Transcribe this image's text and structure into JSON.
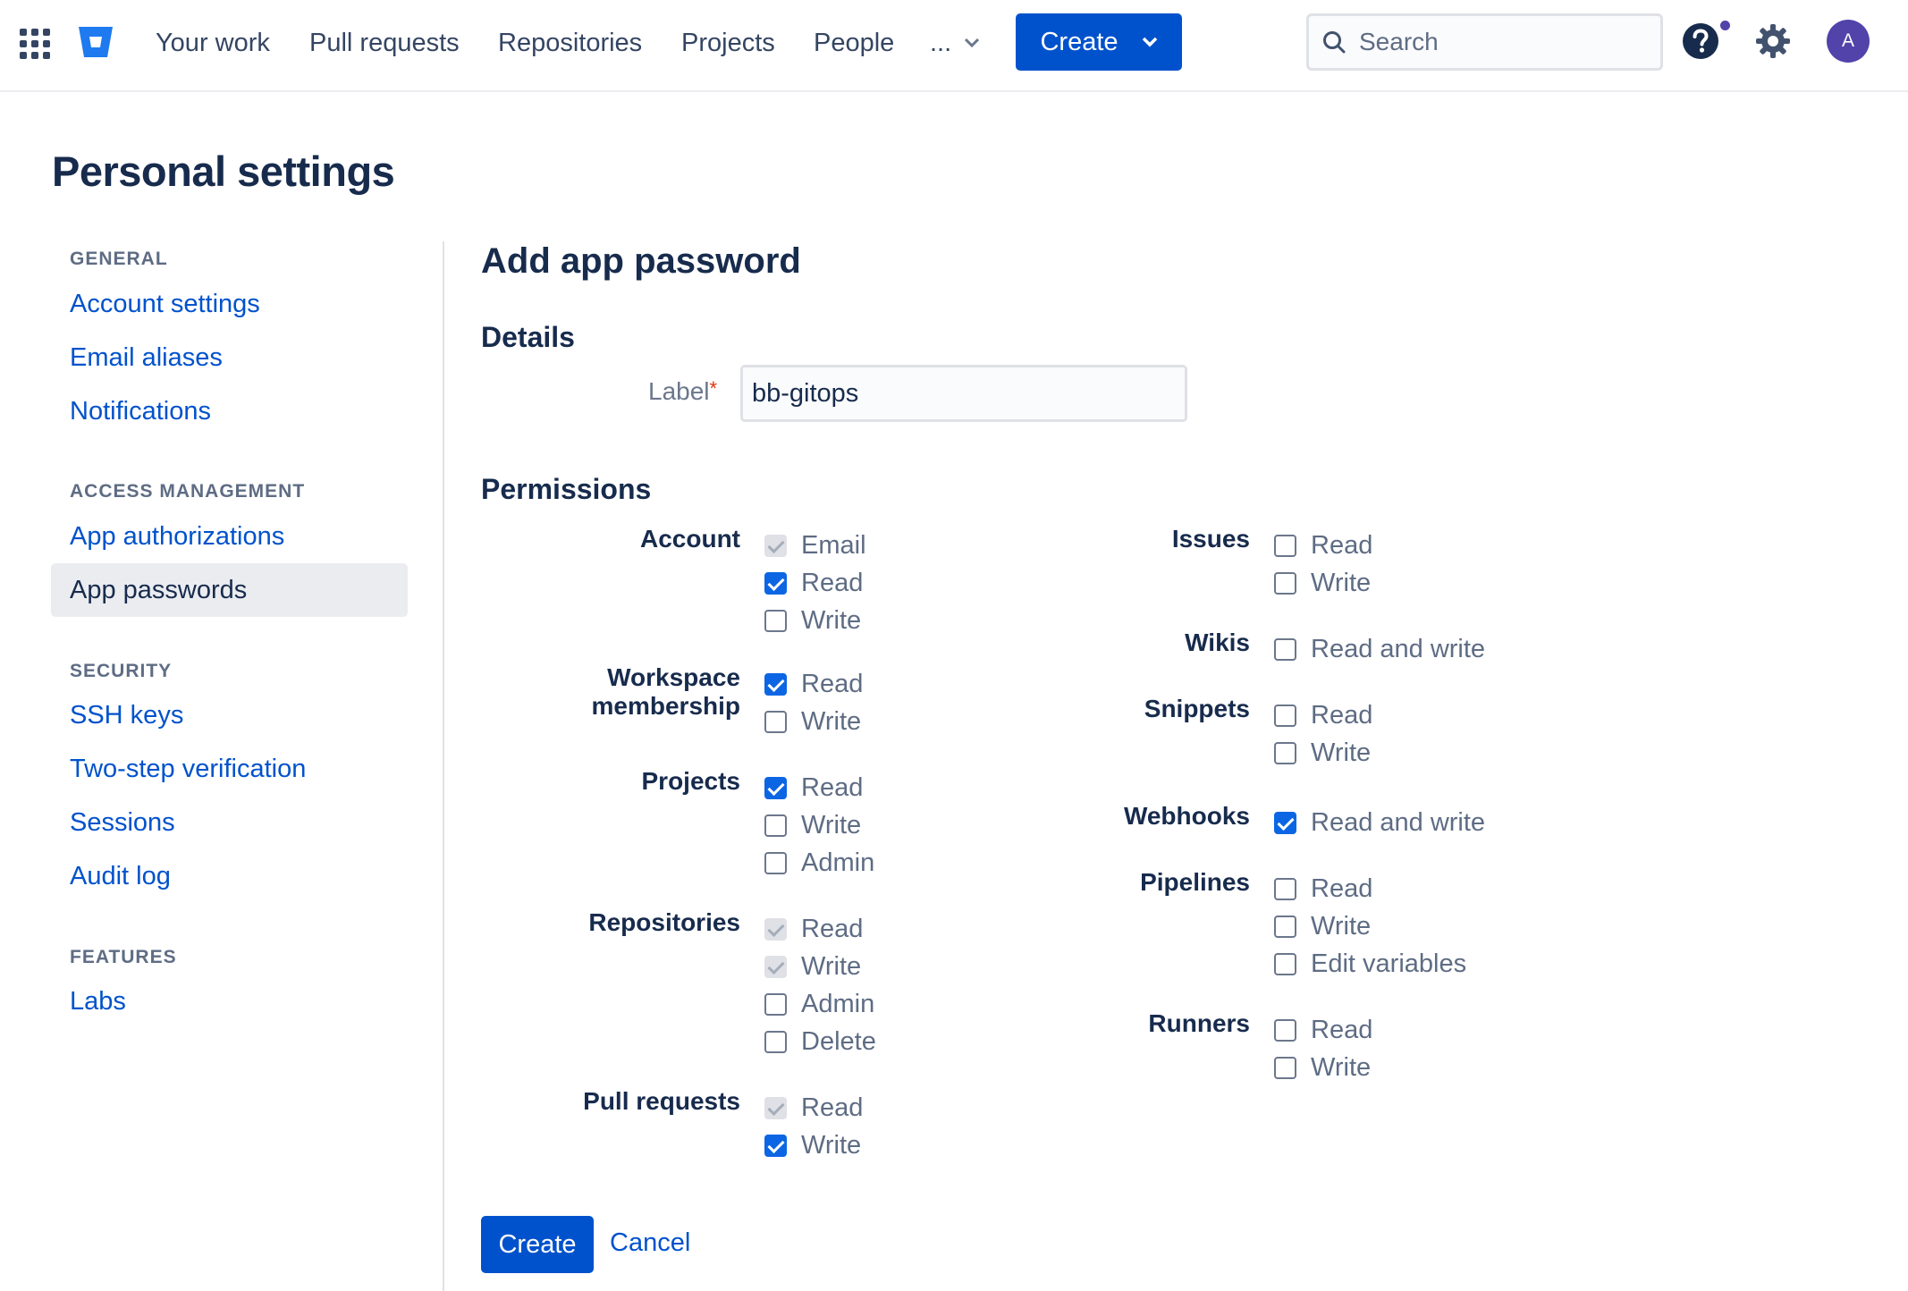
{
  "topnav": {
    "items": [
      "Your work",
      "Pull requests",
      "Repositories",
      "Projects",
      "People"
    ],
    "more_label": "...",
    "create_label": "Create",
    "search_placeholder": "Search",
    "avatar_initial": "A",
    "brand_color": "#0052cc",
    "notification_dot_color": "#5243aa"
  },
  "page": {
    "title": "Personal settings"
  },
  "sidebar": {
    "sections": [
      {
        "heading": "GENERAL",
        "items": [
          "Account settings",
          "Email aliases",
          "Notifications"
        ]
      },
      {
        "heading": "ACCESS MANAGEMENT",
        "items": [
          "App authorizations",
          "App passwords"
        ]
      },
      {
        "heading": "SECURITY",
        "items": [
          "SSH keys",
          "Two-step verification",
          "Sessions",
          "Audit log"
        ]
      },
      {
        "heading": "FEATURES",
        "items": [
          "Labs"
        ]
      }
    ],
    "active_item": "App passwords"
  },
  "form": {
    "title": "Add app password",
    "details_heading": "Details",
    "label_field": {
      "label": "Label",
      "required_mark": "*",
      "value": "bb-gitops"
    },
    "permissions_heading": "Permissions",
    "left_groups": [
      {
        "name": "Account",
        "options": [
          {
            "label": "Email",
            "state": "disabled"
          },
          {
            "label": "Read",
            "state": "checked"
          },
          {
            "label": "Write",
            "state": "unchecked"
          }
        ]
      },
      {
        "name": "Workspace membership",
        "options": [
          {
            "label": "Read",
            "state": "checked"
          },
          {
            "label": "Write",
            "state": "unchecked"
          }
        ]
      },
      {
        "name": "Projects",
        "options": [
          {
            "label": "Read",
            "state": "checked"
          },
          {
            "label": "Write",
            "state": "unchecked"
          },
          {
            "label": "Admin",
            "state": "unchecked"
          }
        ]
      },
      {
        "name": "Repositories",
        "options": [
          {
            "label": "Read",
            "state": "disabled"
          },
          {
            "label": "Write",
            "state": "disabled"
          },
          {
            "label": "Admin",
            "state": "unchecked"
          },
          {
            "label": "Delete",
            "state": "unchecked"
          }
        ]
      },
      {
        "name": "Pull requests",
        "options": [
          {
            "label": "Read",
            "state": "disabled"
          },
          {
            "label": "Write",
            "state": "checked"
          }
        ]
      }
    ],
    "right_groups": [
      {
        "name": "Issues",
        "options": [
          {
            "label": "Read",
            "state": "unchecked"
          },
          {
            "label": "Write",
            "state": "unchecked"
          }
        ]
      },
      {
        "name": "Wikis",
        "options": [
          {
            "label": "Read and write",
            "state": "unchecked"
          }
        ]
      },
      {
        "name": "Snippets",
        "options": [
          {
            "label": "Read",
            "state": "unchecked"
          },
          {
            "label": "Write",
            "state": "unchecked"
          }
        ]
      },
      {
        "name": "Webhooks",
        "options": [
          {
            "label": "Read and write",
            "state": "checked"
          }
        ]
      },
      {
        "name": "Pipelines",
        "options": [
          {
            "label": "Read",
            "state": "unchecked"
          },
          {
            "label": "Write",
            "state": "unchecked"
          },
          {
            "label": "Edit variables",
            "state": "unchecked"
          }
        ]
      },
      {
        "name": "Runners",
        "options": [
          {
            "label": "Read",
            "state": "unchecked"
          },
          {
            "label": "Write",
            "state": "unchecked"
          }
        ]
      }
    ],
    "create_label": "Create",
    "cancel_label": "Cancel"
  }
}
